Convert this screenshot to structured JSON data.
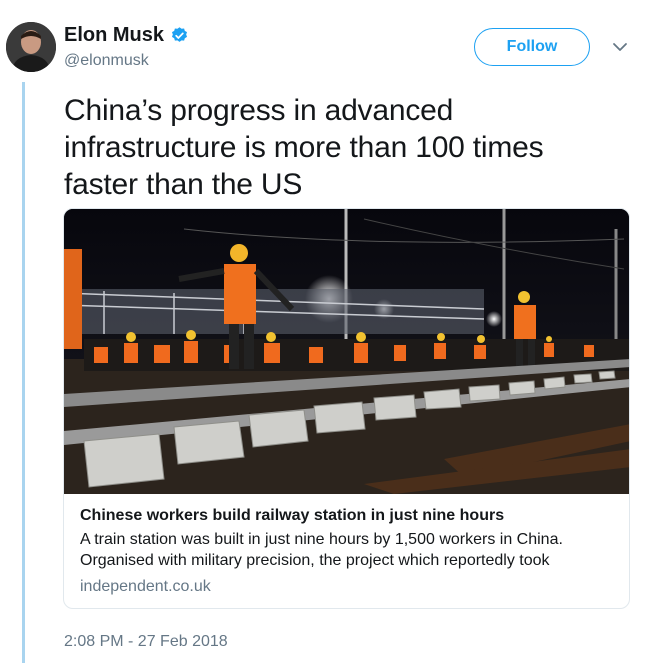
{
  "user": {
    "name": "Elon Musk",
    "handle": "@elonmusk",
    "verified": true,
    "avatar_icon": "person-avatar"
  },
  "actions": {
    "follow_label": "Follow",
    "menu_icon": "chevron-down-icon"
  },
  "tweet": {
    "text": "China’s progress in advanced infrastructure is more than 100 times faster than the US",
    "timestamp": "2:08 PM - 27 Feb 2018"
  },
  "card": {
    "title": "Chinese workers build railway station in just nine hours",
    "description": "A train station was built in just nine hours by 1,500 workers in China. Organised with military precision, the project which reportedly took",
    "domain": "independent.co.uk",
    "image_subject": "railway-construction-photo"
  },
  "colors": {
    "accent": "#1da1f2",
    "thread_line": "#a9d4ef",
    "secondary_text": "#657786",
    "card_border": "#e1e8ed"
  }
}
